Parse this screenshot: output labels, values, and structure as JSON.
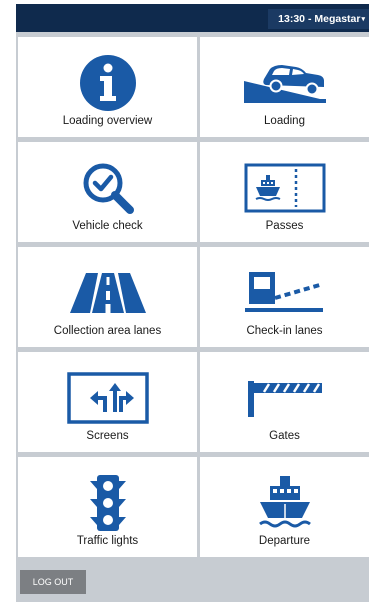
{
  "status_bar": {
    "time": "13:30",
    "separator": " - ",
    "user": "Megastar"
  },
  "tiles": [
    {
      "label": "Loading overview",
      "icon": "info-icon"
    },
    {
      "label": "Loading",
      "icon": "car-on-ramp-icon"
    },
    {
      "label": "Vehicle check",
      "icon": "magnifier-check-icon"
    },
    {
      "label": "Passes",
      "icon": "ship-ticket-icon"
    },
    {
      "label": "Collection area lanes",
      "icon": "lanes-road-icon"
    },
    {
      "label": "Check-in lanes",
      "icon": "barrier-booth-icon"
    },
    {
      "label": "Screens",
      "icon": "lane-arrows-screen-icon"
    },
    {
      "label": "Gates",
      "icon": "gate-barrier-icon"
    },
    {
      "label": "Traffic lights",
      "icon": "traffic-light-icon"
    },
    {
      "label": "Departure",
      "icon": "ship-icon"
    }
  ],
  "footer": {
    "logout_label": "LOG OUT"
  },
  "colors": {
    "accent": "#1a5aa6",
    "topbar": "#0f2a4d",
    "panel": "#c7ccd2",
    "button": "#7c7f83"
  }
}
